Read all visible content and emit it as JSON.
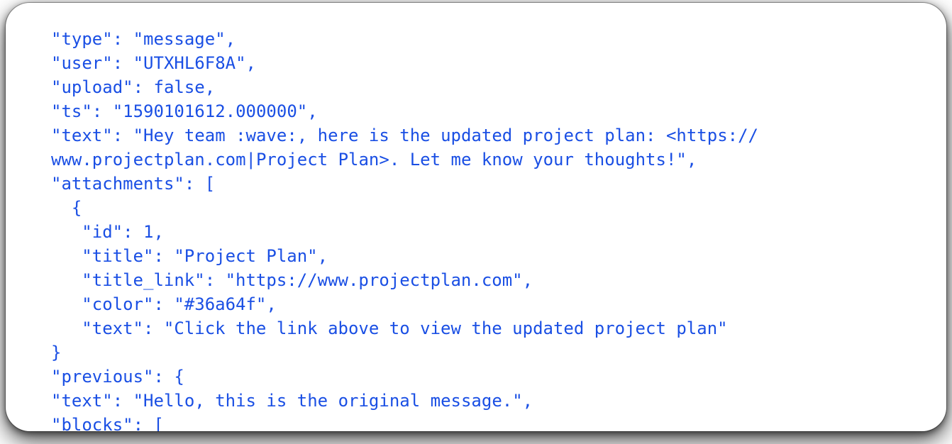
{
  "card": {
    "kind": "json-code-snippet",
    "background_color": "#ffffff",
    "text_color": "#1a4fe4",
    "corner_radius_px": 34
  },
  "code": {
    "language": "json",
    "lines": [
      {
        "indent": 0,
        "text": "\"type\": \"message\","
      },
      {
        "indent": 0,
        "text": "\"user\": \"UTXHL6F8A\","
      },
      {
        "indent": 0,
        "text": "\"upload\": false,"
      },
      {
        "indent": 0,
        "text": "\"ts\": \"1590101612.000000\","
      },
      {
        "indent": 0,
        "text": "\"text\": \"Hey team :wave:, here is the updated project plan: <https://"
      },
      {
        "indent": 0,
        "text": "www.projectplan.com|Project Plan>. Let me know your thoughts!\","
      },
      {
        "indent": 0,
        "text": "\"attachments\": ["
      },
      {
        "indent": 1,
        "text": "{"
      },
      {
        "indent": 2,
        "text": "\"id\": 1,"
      },
      {
        "indent": 2,
        "text": "\"title\": \"Project Plan\","
      },
      {
        "indent": 2,
        "text": "\"title_link\": \"https://www.projectplan.com\","
      },
      {
        "indent": 2,
        "text": "\"color\": \"#36a64f\","
      },
      {
        "indent": 2,
        "text": "\"text\": \"Click the link above to view the updated project plan\""
      },
      {
        "indent": 0,
        "text": "}"
      },
      {
        "indent": 0,
        "text": "\"previous\": {"
      },
      {
        "indent": 0,
        "text": "\"text\": \"Hello, this is the original message.\","
      },
      {
        "indent": 0,
        "text": "\"blocks\": ["
      }
    ],
    "values": {
      "type": "message",
      "user": "UTXHL6F8A",
      "upload": "false",
      "ts": "1590101612.000000",
      "text": "Hey team :wave:, here is the updated project plan: <https://www.projectplan.com|Project Plan>. Let me know your thoughts!",
      "attachment_id": "1",
      "attachment_title": "Project Plan",
      "attachment_title_link": "https://www.projectplan.com",
      "attachment_color": "#36a64f",
      "attachment_text": "Click the link above to view the updated project plan",
      "previous_text": "Hello, this is the original message."
    }
  }
}
